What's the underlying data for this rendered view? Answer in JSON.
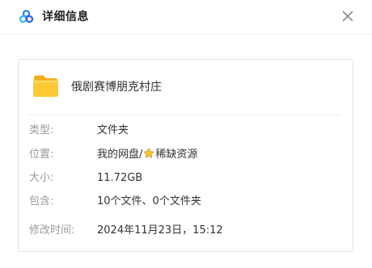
{
  "dialog": {
    "title": "详细信息",
    "close_icon": "close-icon",
    "app_icon": "baidu-netdisk-logo-icon"
  },
  "file": {
    "icon": "folder-icon",
    "name": "俄剧赛博朋克村庄"
  },
  "details": [
    {
      "label": "类型:",
      "value": "文件夹"
    },
    {
      "label": "位置:",
      "value_prefix": "我的网盘/",
      "value_icon": "star-icon",
      "value_suffix": "稀缺资源"
    },
    {
      "label": "大小:",
      "value": "11.72GB"
    },
    {
      "label": "包含:",
      "value": "10个文件、0个文件夹"
    },
    {
      "label": "修改时间:",
      "value": "2024年11月23日，15:12"
    }
  ],
  "colors": {
    "label_text": "#999999",
    "value_text": "#333333",
    "folder_yellow": "#ffc933",
    "star_yellow": "#f7c531"
  }
}
